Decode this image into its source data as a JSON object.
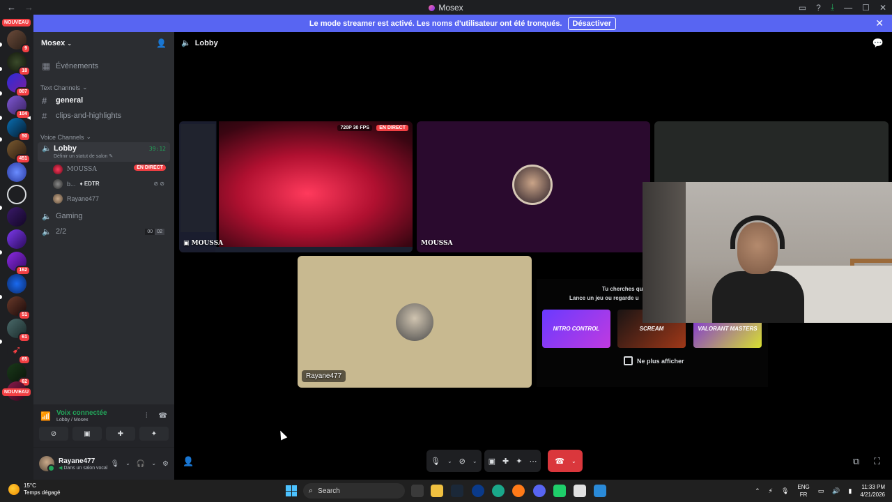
{
  "window": {
    "title": "Mosex",
    "back": "←",
    "forward": "→"
  },
  "banner": {
    "message": "Le mode streamer est activé. Les noms d'utilisateur ont été tronqués.",
    "button": "Désactiver",
    "close": "✕"
  },
  "rail": {
    "new_label": "NOUVEAU",
    "badges": [
      "9",
      "18",
      "807",
      "104",
      "50",
      "451",
      "162",
      "51",
      "61",
      "65",
      "62"
    ]
  },
  "server": {
    "name": "Mosex",
    "events": "Événements"
  },
  "text_channels": {
    "category": "Text Channels",
    "items": [
      {
        "name": "general"
      },
      {
        "name": "clips-and-highlights"
      }
    ]
  },
  "voice_channels": {
    "category": "Voice Channels",
    "lobby": {
      "name": "Lobby",
      "status_hint": "Définir un statut de salon",
      "timer": "39:12"
    },
    "users": [
      {
        "name": "MOUSSA",
        "badge": "EN DIRECT"
      },
      {
        "name": "b...",
        "tag": "EDTR"
      },
      {
        "name": "Rayane477"
      }
    ],
    "others": [
      {
        "name": "Gaming"
      },
      {
        "name": "2/2",
        "count_a": "00",
        "count_b": "02"
      }
    ]
  },
  "voice_panel": {
    "status": "Voix connectée",
    "location": "Lobby / Mosex"
  },
  "user_panel": {
    "name": "Rayane477",
    "status": "Dans un salon vocal"
  },
  "main": {
    "channel": "Lobby"
  },
  "tiles": {
    "stream": {
      "name": "MOUSSA",
      "quality": "720P 30 FPS",
      "live": "EN DIRECT"
    },
    "moussa": {
      "name": "MOUSSA"
    },
    "rayane": {
      "name": "Rayane477"
    }
  },
  "promo": {
    "line1": "Tu cherches qu",
    "line2": "Lance un jeu ou regarde u",
    "games": [
      "NITRO CONTROL",
      "SCREAM",
      "VALORANT MASTERS"
    ],
    "checkbox": "Ne plus afficher"
  },
  "taskbar": {
    "temp": "15°C",
    "weather": "Temps dégagé",
    "search": "Search",
    "lang_top": "ENG",
    "lang_bottom": "FR",
    "time": "11:33 PM",
    "date": "4/21/2026"
  },
  "colors": {
    "blurple": "#5865f2",
    "green": "#23a55a",
    "red": "#f23f43",
    "hangup": "#da373c"
  }
}
